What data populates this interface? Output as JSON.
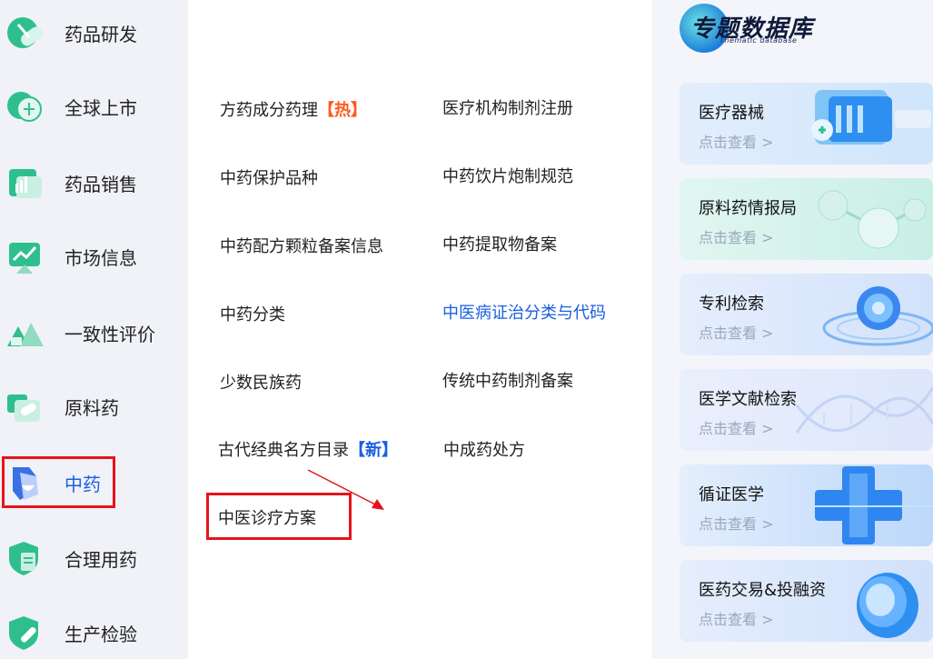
{
  "sidebar": {
    "items": [
      {
        "label": "药品研发",
        "icon": "pill-icon"
      },
      {
        "label": "全球上市",
        "icon": "globe-icon"
      },
      {
        "label": "药品销售",
        "icon": "sales-chart-icon"
      },
      {
        "label": "市场信息",
        "icon": "market-trend-icon"
      },
      {
        "label": "一致性评价",
        "icon": "mountain-icon"
      },
      {
        "label": "原料药",
        "icon": "capsule-icon"
      },
      {
        "label": "中药",
        "icon": "herbal-bowl-icon"
      },
      {
        "label": "合理用药",
        "icon": "shield-doc-icon"
      },
      {
        "label": "生产检验",
        "icon": "shield-syringe-icon"
      }
    ],
    "active": "中药"
  },
  "menu": {
    "col1": [
      {
        "label": "方药成分药理",
        "tag": "【热】"
      },
      {
        "label": "中药保护品种"
      },
      {
        "label": "中药配方颗粒备案信息"
      },
      {
        "label": "中药分类"
      },
      {
        "label": "少数民族药"
      },
      {
        "label": "古代经典名方目录",
        "tag": "【新】"
      },
      {
        "label": "中医诊疗方案"
      }
    ],
    "col2": [
      {
        "label": "医疗机构制剂注册"
      },
      {
        "label": "中药饮片炮制规范"
      },
      {
        "label": "中药提取物备案"
      },
      {
        "label": "中医病证治分类与代码"
      },
      {
        "label": "传统中药制剂备案"
      },
      {
        "label": "中成药处方"
      }
    ]
  },
  "database": {
    "title": "专题数据库",
    "subtitle": "Thematic database",
    "cards": [
      {
        "title": "医疗器械",
        "sub": "点击查看 >"
      },
      {
        "title": "原料药情报局",
        "sub": "点击查看 >"
      },
      {
        "title": "专利检索",
        "sub": "点击查看 >"
      },
      {
        "title": "医学文献检索",
        "sub": "点击查看 >"
      },
      {
        "title": "循证医学",
        "sub": "点击查看 >"
      },
      {
        "title": "医药交易&投融资",
        "sub": "点击查看 >"
      }
    ]
  },
  "colors": {
    "accent_blue": "#1a5fe0",
    "highlight_red": "#e5141b",
    "hot_orange": "#ff5a1f",
    "icon_green": "#2fbf8f"
  }
}
